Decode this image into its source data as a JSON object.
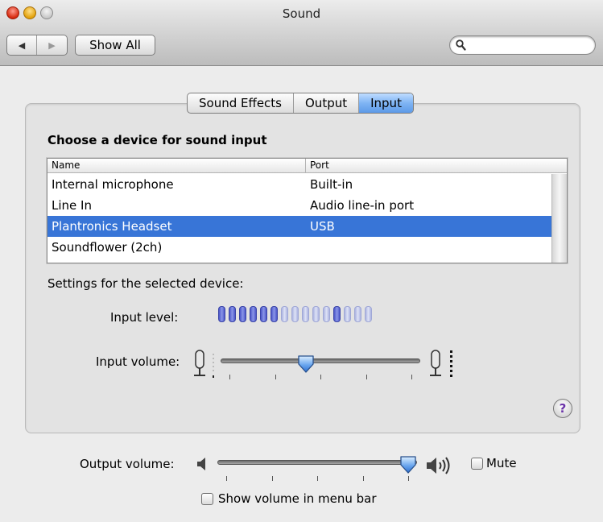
{
  "window": {
    "title": "Sound"
  },
  "toolbar": {
    "back_icon": "◀",
    "forward_icon": "▶",
    "show_all_label": "Show All",
    "search_placeholder": "",
    "search_value": ""
  },
  "tabs": [
    {
      "label": "Sound Effects",
      "selected": false
    },
    {
      "label": "Output",
      "selected": false
    },
    {
      "label": "Input",
      "selected": true
    }
  ],
  "input_pane": {
    "choose_label": "Choose a device for sound input",
    "table": {
      "columns": [
        "Name",
        "Port"
      ],
      "rows": [
        {
          "name": "Internal microphone",
          "port": "Built-in",
          "selected": false
        },
        {
          "name": "Line In",
          "port": "Audio line-in port",
          "selected": false
        },
        {
          "name": "Plantronics Headset",
          "port": "USB",
          "selected": true
        },
        {
          "name": "Soundflower (2ch)",
          "port": "",
          "selected": false
        }
      ]
    },
    "settings_label": "Settings for the selected device:",
    "input_level_label": "Input level:",
    "input_level": {
      "segments": 15,
      "lit": [
        0,
        1,
        2,
        3,
        4,
        5,
        11
      ]
    },
    "input_volume_label": "Input volume:",
    "input_volume_fraction": 0.42,
    "help_label": "?"
  },
  "output": {
    "output_volume_label": "Output volume:",
    "output_volume_fraction": 1.0,
    "mute_label": "Mute",
    "mute_checked": false,
    "show_volume_label": "Show volume in menu bar",
    "show_volume_checked": false
  },
  "colors": {
    "selection": "#3875d7",
    "tab_selected": "#7fb4f4",
    "level_on": "#4a55c8",
    "level_off": "#c6cbee"
  }
}
